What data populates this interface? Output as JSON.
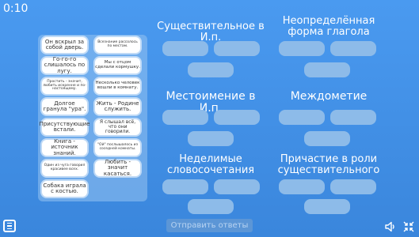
{
  "timer": "0:10",
  "cards": [
    {
      "text": "Он вскрыл за собой дверь."
    },
    {
      "text": "Всезнание рассолось по местам."
    },
    {
      "text": "Го-го-го слишалось по лугу."
    },
    {
      "text": "Мы с отцом сделали кормушку."
    },
    {
      "text": "Простить - значит, любить искренне и по-настоящему."
    },
    {
      "text": "Несколько человек вошли в комнату."
    },
    {
      "text": "Долгое гранула \"ура\"."
    },
    {
      "text": "Жить - Родине служить."
    },
    {
      "text": "Присутствующие встали."
    },
    {
      "text": "Я слышал всё, что они говорили."
    },
    {
      "text": "Книга - источник знаний."
    },
    {
      "text": "\"Ой\" послышалось из соседней комнаты."
    },
    {
      "text": "Один из чуга говорил красивее всех."
    },
    {
      "text": "Любить - значит касаться."
    },
    {
      "text": "Собака играла с костью."
    }
  ],
  "categories": [
    {
      "label": "Существительное в И.п."
    },
    {
      "label": "Неопределённая форма глагола"
    },
    {
      "label": "Местоимение в И.п."
    },
    {
      "label": "Междометие"
    },
    {
      "label": "Неделимые словосочетания"
    },
    {
      "label": "Причастие в роли существительного"
    }
  ],
  "submit_label": "Отправить ответы",
  "icons": [
    "menu-icon",
    "speaker-icon",
    "collapse-icon"
  ]
}
